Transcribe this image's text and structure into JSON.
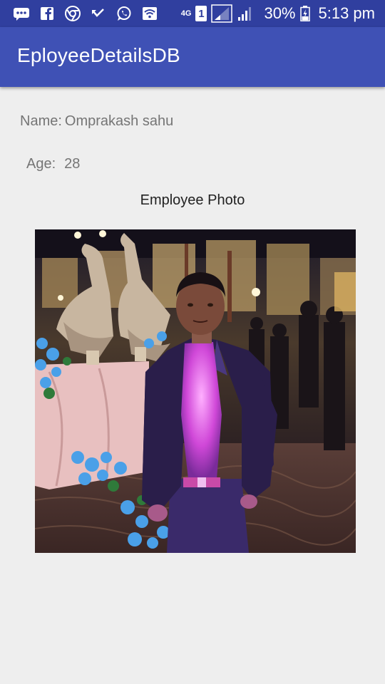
{
  "status_bar": {
    "icons": [
      "messages-icon",
      "facebook-icon",
      "chrome-icon",
      "missed-call-icon",
      "whatsapp-icon",
      "wifi-icon",
      "4g-icon",
      "sim-1-icon",
      "signal-1-icon",
      "signal-2-icon",
      "battery-icon"
    ],
    "battery_level": "30%",
    "time": "5:13 pm",
    "network_label": "4G",
    "sim_label": "1"
  },
  "app_bar": {
    "title": "EployeeDetailsDB",
    "color": "#3f51b5",
    "status_color": "#303f9f"
  },
  "employee": {
    "name_label": "Name:",
    "name_value": "Omprakash sahu",
    "age_label": "Age:",
    "age_value": "28",
    "photo_caption": "Employee Photo"
  }
}
